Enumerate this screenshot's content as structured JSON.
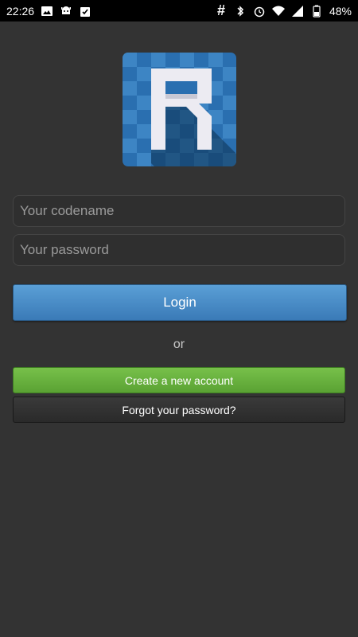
{
  "status_bar": {
    "time": "22:26",
    "battery": "48%",
    "icons_left": [
      "image-icon",
      "android-debug-icon",
      "clipboard-check-icon"
    ],
    "icons_right": [
      "hash-icon",
      "bluetooth-icon",
      "alarm-icon",
      "wifi-icon",
      "signal-icon",
      "battery-icon"
    ]
  },
  "login_form": {
    "codename_placeholder": "Your codename",
    "password_placeholder": "Your password",
    "login_label": "Login",
    "or_label": "or",
    "create_account_label": "Create a new account",
    "forgot_password_label": "Forgot your password?"
  },
  "colors": {
    "background": "#333333",
    "login_button": "#4a8cc8",
    "create_button": "#6ab23e",
    "forgot_button": "#303030",
    "logo_blue": "#2a6fb0"
  }
}
